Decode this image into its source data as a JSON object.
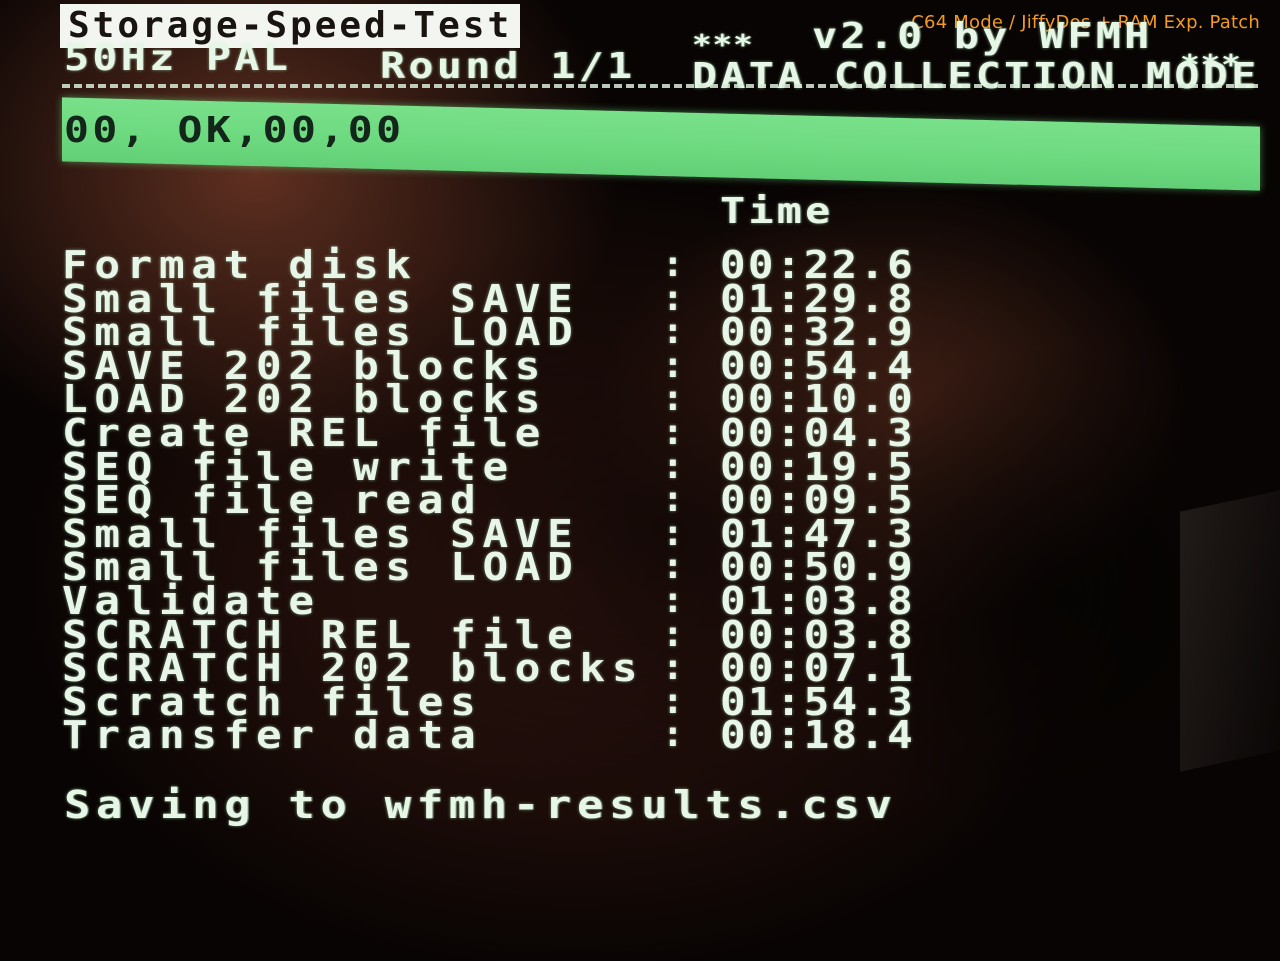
{
  "overlay_caption": "C64 Mode / JiffyDos + RAM Exp. Patch",
  "header": {
    "title": "Storage-Speed-Test",
    "stars_left": "***",
    "version_by": "v2.0 by WFMH",
    "stars_right": "***",
    "video_mode": "50Hz PAL",
    "round": "Round 1/1",
    "mode": "DATA COLLECTION MODE"
  },
  "status": {
    "text": "00, OK,00,00",
    "bar_color": "#6cd97f"
  },
  "results": {
    "time_header": "Time",
    "separator": ":",
    "rows": [
      {
        "label": "Format disk",
        "time": "00:22.6"
      },
      {
        "label": "Small files SAVE",
        "time": "01:29.8"
      },
      {
        "label": "Small files LOAD",
        "time": "00:32.9"
      },
      {
        "label": "SAVE 202 blocks",
        "time": "00:54.4"
      },
      {
        "label": "LOAD 202 blocks",
        "time": "00:10.0"
      },
      {
        "label": "Create REL file",
        "time": "00:04.3"
      },
      {
        "label": "SEQ file write",
        "time": "00:19.5"
      },
      {
        "label": "SEQ file read",
        "time": "00:09.5"
      },
      {
        "label": "Small files SAVE",
        "time": "01:47.3"
      },
      {
        "label": "Small files LOAD",
        "time": "00:50.9"
      },
      {
        "label": "Validate",
        "time": "01:03.8"
      },
      {
        "label": "SCRATCH REL file",
        "time": "00:03.8"
      },
      {
        "label": "SCRATCH 202 blocks",
        "time": "00:07.1"
      },
      {
        "label": "Scratch files",
        "time": "01:54.3"
      },
      {
        "label": "Transfer data",
        "time": "00:18.4"
      }
    ]
  },
  "footer": {
    "saving_message": "Saving to wfmh-results.csv"
  },
  "colors": {
    "text": "#e6f7e8",
    "status_bar": "#6cd97f",
    "caption": "#f39a1f",
    "title_background": "#f2f5f0"
  }
}
